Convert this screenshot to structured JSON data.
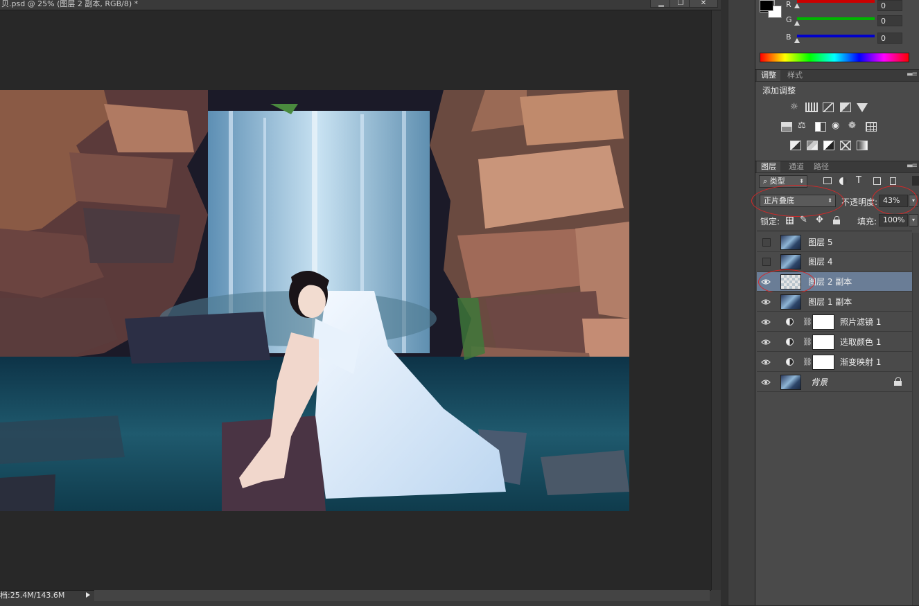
{
  "document": {
    "title": "贝.psd @ 25% (图层 2 副本, RGB/8) *",
    "status": "档:25.4M/143.6M"
  },
  "window_controls": {
    "minimize": "▁",
    "restore": "❐",
    "close": "✕"
  },
  "color_panel": {
    "fg_color": "#000000",
    "bg_color": "#ffffff",
    "channels": [
      {
        "label": "R",
        "value": "0",
        "color": "#cc0000"
      },
      {
        "label": "G",
        "value": "0",
        "color": "#00b400"
      },
      {
        "label": "B",
        "value": "0",
        "color": "#0000cc"
      }
    ]
  },
  "adjustments_panel": {
    "tabs": [
      {
        "label": "调整",
        "active": true
      },
      {
        "label": "样式",
        "active": false
      }
    ],
    "heading": "添加调整",
    "icon_rows": [
      [
        "brightness-contrast-icon",
        "levels-icon",
        "curves-icon",
        "exposure-icon",
        "vibrance-icon"
      ],
      [
        "hue-saturation-icon",
        "color-balance-icon",
        "black-white-icon",
        "photo-filter-icon",
        "channel-mixer-icon",
        "color-lookup-icon"
      ],
      [
        "invert-icon",
        "posterize-icon",
        "threshold-icon",
        "selective-color-icon",
        "gradient-map-icon"
      ]
    ]
  },
  "layers_panel": {
    "tabs": [
      {
        "label": "图层",
        "active": true
      },
      {
        "label": "通道",
        "active": false
      },
      {
        "label": "路径",
        "active": false
      }
    ],
    "filter_kind": "类型",
    "blend_mode": "正片叠底",
    "opacity_label": "不透明度:",
    "opacity_value": "43%",
    "lock_label": "锁定:",
    "fill_label": "填充:",
    "fill_value": "100%",
    "layers": [
      {
        "name": "图层 5",
        "visible": false,
        "selected": false,
        "type": "pixel"
      },
      {
        "name": "图层 4",
        "visible": false,
        "selected": false,
        "type": "pixel"
      },
      {
        "name": "图层 2 副本",
        "visible": true,
        "selected": true,
        "type": "transparent"
      },
      {
        "name": "图层 1 副本",
        "visible": true,
        "selected": false,
        "type": "pixel"
      },
      {
        "name": "照片滤镜 1",
        "visible": true,
        "selected": false,
        "type": "adjustment"
      },
      {
        "name": "选取颜色 1",
        "visible": true,
        "selected": false,
        "type": "adjustment"
      },
      {
        "name": "渐变映射 1",
        "visible": true,
        "selected": false,
        "type": "adjustment"
      },
      {
        "name": "背景",
        "visible": true,
        "selected": false,
        "type": "background",
        "locked": true
      }
    ]
  }
}
